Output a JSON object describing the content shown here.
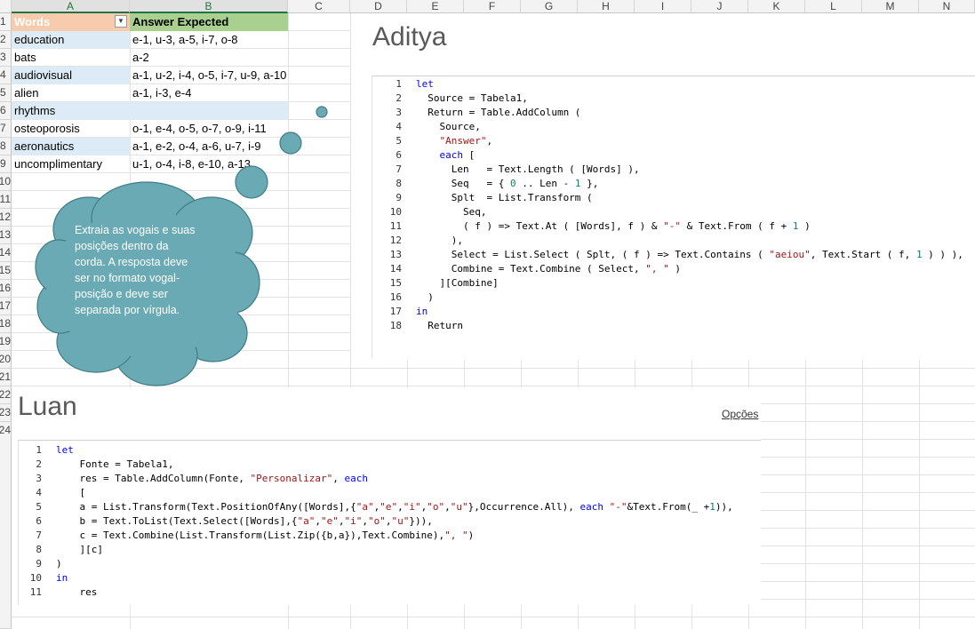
{
  "sheet": {
    "columns": [
      "A",
      "B",
      "C",
      "D",
      "E",
      "F",
      "G",
      "H",
      "I",
      "J",
      "K",
      "L",
      "M",
      "N"
    ],
    "rows": [
      "1",
      "2",
      "3",
      "4",
      "5",
      "6",
      "7",
      "8",
      "9",
      "10",
      "11",
      "12",
      "13",
      "14",
      "15",
      "16",
      "17",
      "18",
      "19",
      "20",
      "21",
      "22",
      "23",
      "24"
    ]
  },
  "table": {
    "headers": {
      "words": "Words",
      "answer": "Answer Expected"
    },
    "filter_icon": "filter-dropdown-icon",
    "rows": [
      {
        "word": "education",
        "answer": "e-1, u-3, a-5, i-7, o-8"
      },
      {
        "word": "bats",
        "answer": "a-2"
      },
      {
        "word": "audiovisual",
        "answer": "a-1, u-2, i-4, o-5, i-7, u-9, a-10"
      },
      {
        "word": "alien",
        "answer": "a-1, i-3, e-4"
      },
      {
        "word": "rhythms",
        "answer": ""
      },
      {
        "word": "osteoporosis",
        "answer": "o-1, e-4, o-5, o-7, o-9, i-11"
      },
      {
        "word": "aeronautics",
        "answer": "a-1, e-2, o-4, a-6, u-7, i-9"
      },
      {
        "word": "uncomplimentary",
        "answer": "u-1, o-4, i-8, e-10, a-13"
      }
    ]
  },
  "callout": {
    "text": "Extraia as vogais e suas posições dentro da corda. A resposta deve ser no formato vogal-posição e deve ser separada por vírgula.",
    "lines": [
      "Extraia as vogais e suas",
      "posições dentro da",
      "corda. A resposta deve",
      "ser no formato vogal-",
      "posição e deve ser",
      "separada por vírgula."
    ],
    "color": "#6aaab5"
  },
  "aditya": {
    "title": "Aditya",
    "code": [
      "let",
      "  Source = Tabela1,",
      "  Return = Table.AddColumn (",
      "    Source,",
      "    \"Answer\",",
      "    each [",
      "      Len   = Text.Length ( [Words] ),",
      "      Seq   = { 0 .. Len - 1 },",
      "      Splt  = List.Transform (",
      "        Seq,",
      "        ( f ) => Text.At ( [Words], f ) & \"-\" & Text.From ( f + 1 )",
      "      ),",
      "      Select = List.Select ( Splt, ( f ) => Text.Contains ( \"aeiou\", Text.Start ( f, 1 ) ) ),",
      "      Combine = Text.Combine ( Select, \", \" )",
      "    ][Combine]",
      "  )",
      "in",
      "  Return"
    ]
  },
  "luan": {
    "title": "Luan",
    "options_label": "Opções",
    "code": [
      "let",
      "    Fonte = Tabela1,",
      "    res = Table.AddColumn(Fonte, \"Personalizar\", each",
      "    [",
      "    a = List.Transform(Text.PositionOfAny([Words],{\"a\",\"e\",\"i\",\"o\",\"u\"},Occurrence.All), each \"-\"&Text.From(_ +1)),",
      "    b = Text.ToList(Text.Select([Words],{\"a\",\"e\",\"i\",\"o\",\"u\"})),",
      "    c = Text.Combine(List.Transform(List.Zip({b,a}),Text.Combine),\", \")",
      "    ][c]",
      ")",
      "in",
      "    res"
    ]
  }
}
